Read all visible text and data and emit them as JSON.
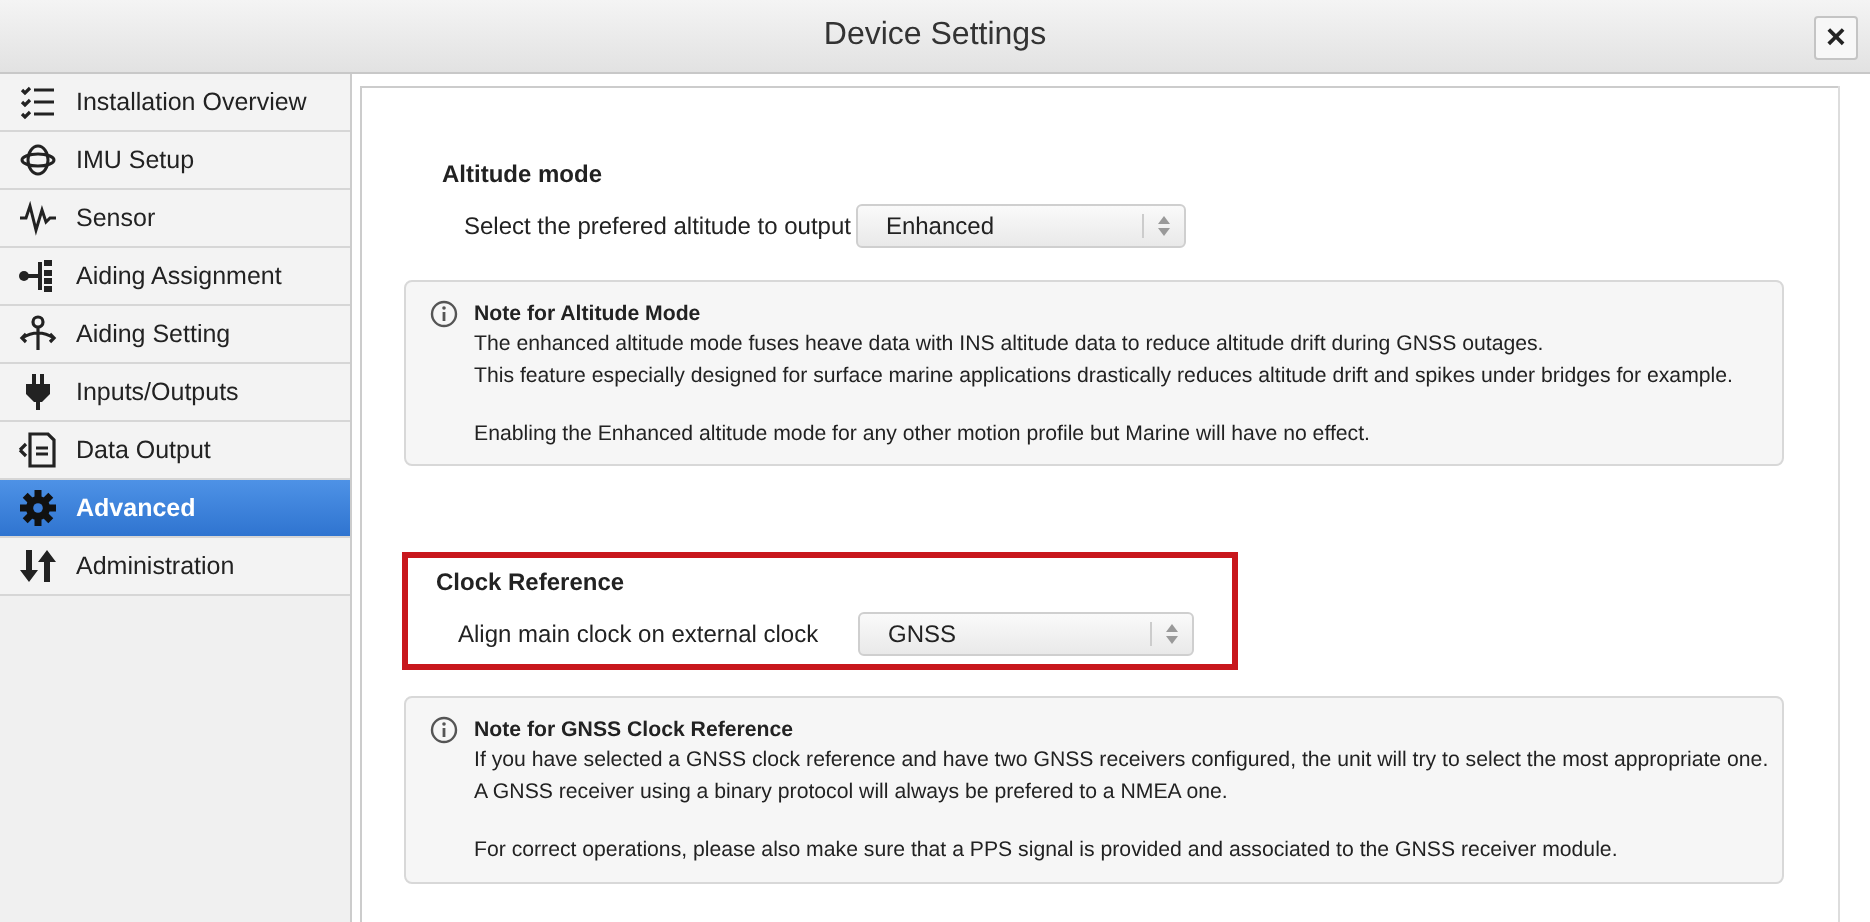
{
  "window": {
    "title": "Device Settings",
    "close": "×"
  },
  "sidebar": {
    "items": [
      {
        "label": "Installation Overview",
        "selected": false
      },
      {
        "label": "IMU Setup",
        "selected": false
      },
      {
        "label": "Sensor",
        "selected": false
      },
      {
        "label": "Aiding Assignment",
        "selected": false
      },
      {
        "label": "Aiding Setting",
        "selected": false
      },
      {
        "label": "Inputs/Outputs",
        "selected": false
      },
      {
        "label": "Data Output",
        "selected": false
      },
      {
        "label": "Advanced",
        "selected": true
      },
      {
        "label": "Administration",
        "selected": false
      }
    ]
  },
  "sections": [
    {
      "title": "Altitude mode",
      "highlighted": false,
      "field_label": "Select the prefered altitude to output",
      "value": "Enhanced",
      "note": {
        "title": "Note for Altitude Mode",
        "paragraphs": [
          [
            "The enhanced altitude mode fuses heave data with INS altitude data to reduce altitude drift during GNSS outages.",
            "This feature especially designed for surface marine applications drastically reduces altitude drift and spikes under bridges for example."
          ],
          [
            "Enabling the Enhanced altitude mode for any other motion profile but Marine will have no effect."
          ]
        ]
      }
    },
    {
      "title": "Clock Reference",
      "highlighted": true,
      "field_label": "Align main clock on external clock",
      "value": "GNSS",
      "note": {
        "title": "Note for GNSS Clock Reference",
        "paragraphs": [
          [
            "If you have selected a GNSS clock reference and have two GNSS receivers configured, the unit will try to select the most appropriate one.",
            "A GNSS receiver using a binary protocol will always be prefered to a NMEA one."
          ],
          [
            "For correct operations, please also make sure that a PPS signal is provided and associated to the GNSS receiver module."
          ]
        ]
      }
    }
  ]
}
